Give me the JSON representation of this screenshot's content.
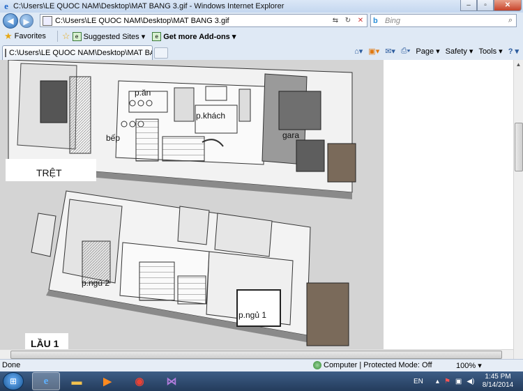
{
  "window": {
    "title": "C:\\Users\\LE QUOC NAM\\Desktop\\MAT BANG 3.gif - Windows Internet Explorer"
  },
  "address_bar": {
    "url": "C:\\Users\\LE QUOC NAM\\Desktop\\MAT BANG 3.gif"
  },
  "search": {
    "engine": "Bing",
    "placeholder": "Bing"
  },
  "favorites_bar": {
    "favorites_label": "Favorites",
    "suggested_sites": "Suggested Sites ▾",
    "get_more_addons": "Get more Add-ons ▾"
  },
  "tab": {
    "title": "C:\\Users\\LE QUOC NAM\\Desktop\\MAT BANG 3.gif"
  },
  "command_bar": {
    "page": "Page ▾",
    "safety": "Safety ▾",
    "tools": "Tools ▾",
    "help": "? ▾"
  },
  "image": {
    "floor_ground": "TRỆT",
    "floor_first": "LẦU 1",
    "rooms": {
      "dining": "p.ăn",
      "living": "p.khách",
      "kitchen": "bếp",
      "garage": "gara",
      "bedroom2": "p.ngủ 2",
      "bedroom1": "p.ngủ 1"
    }
  },
  "status_bar": {
    "status": "Done",
    "zone": "Computer | Protected Mode: Off",
    "zoom": "100% ▾"
  },
  "taskbar": {
    "language": "EN",
    "time": "1:45 PM",
    "date": "8/14/2014"
  }
}
